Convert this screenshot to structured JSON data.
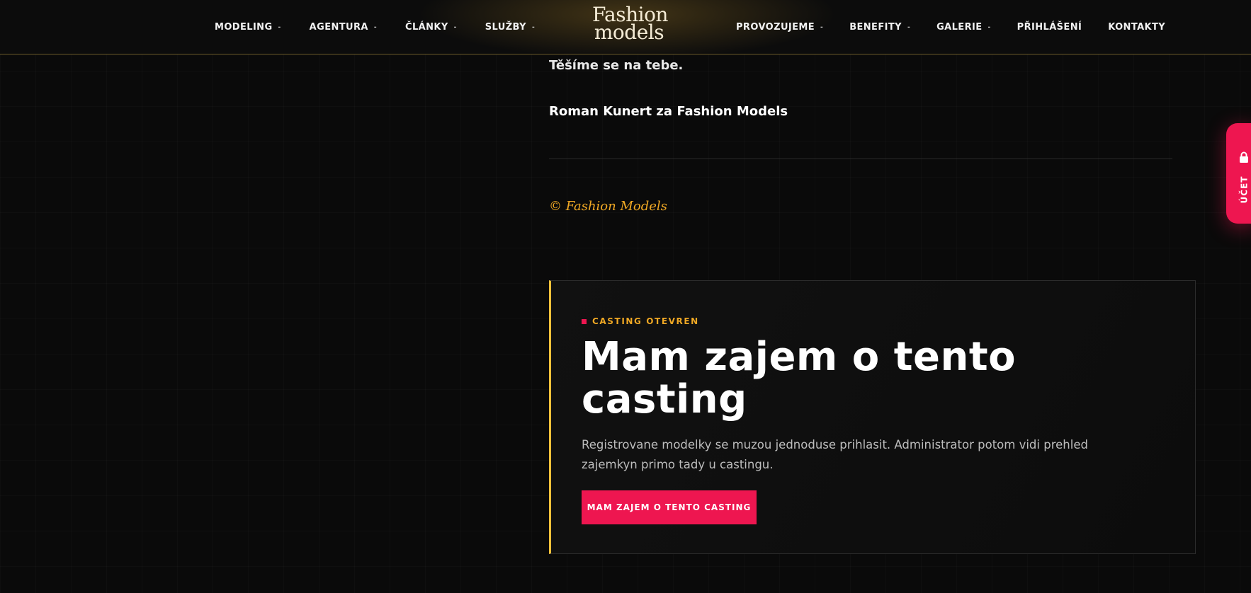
{
  "header": {
    "logo_line1": "Fashion",
    "logo_line2": "models",
    "nav_left": [
      {
        "label": "MODELING",
        "caret": "-"
      },
      {
        "label": "AGENTURA",
        "caret": "-"
      },
      {
        "label": "ČLÁNKY",
        "caret": "-"
      },
      {
        "label": "SLUŽBY",
        "caret": "-"
      }
    ],
    "nav_right": [
      {
        "label": "PROVOZUJEME",
        "caret": "-"
      },
      {
        "label": "BENEFITY",
        "caret": "-"
      },
      {
        "label": "GALERIE",
        "caret": "-"
      },
      {
        "label": "PŘIHLÁŠENÍ"
      },
      {
        "label": "KONTAKTY"
      }
    ]
  },
  "article": {
    "closing_line": "Těšíme se na tebe.",
    "signature": "Roman Kunert za Fashion Models",
    "copyright": "© Fashion Models"
  },
  "casting_card": {
    "badge": "CASTING OTEVREN",
    "title": "Mam zajem o tento casting",
    "description": "Registrovane modelky se muzou jednoduse prihlasit. Administrator potom vidi prehled zajemkyn primo tady u castingu.",
    "button_label": "MAM ZAJEM O TENTO CASTING"
  },
  "account_tab": {
    "label": "ÚČET",
    "icon": "lock-icon"
  },
  "colors": {
    "accent_pink": "#ee1650",
    "accent_gold": "#f0a824",
    "card_border_gold": "#f3c13a",
    "background": "#0a0a0a"
  }
}
